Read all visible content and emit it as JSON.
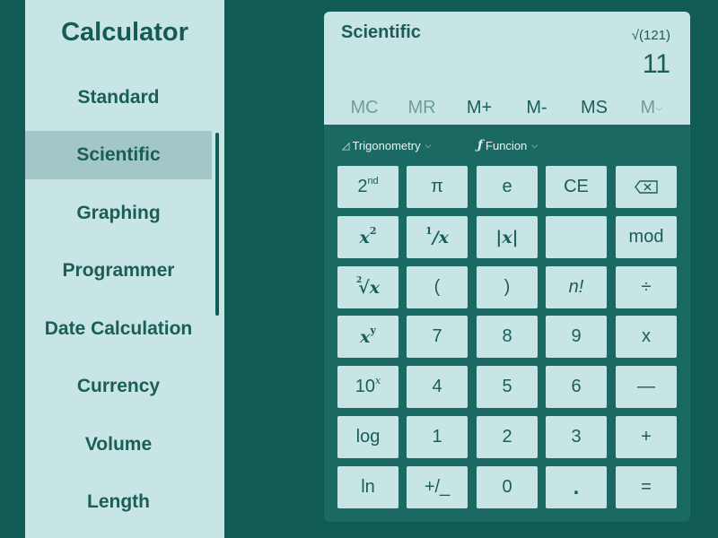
{
  "app": {
    "title": "Calculator"
  },
  "sidebar": {
    "items": [
      {
        "label": "Standard",
        "active": false
      },
      {
        "label": "Scientific",
        "active": true
      },
      {
        "label": "Graphing",
        "active": false
      },
      {
        "label": "Programmer",
        "active": false
      },
      {
        "label": "Date Calculation",
        "active": false
      },
      {
        "label": "Currency",
        "active": false
      },
      {
        "label": "Volume",
        "active": false
      },
      {
        "label": "Length",
        "active": false
      }
    ]
  },
  "display": {
    "mode": "Scientific",
    "expression": "√(121)",
    "result": "11"
  },
  "memory": {
    "buttons": [
      {
        "label": "MC",
        "enabled": false
      },
      {
        "label": "MR",
        "enabled": false
      },
      {
        "label": "M+",
        "enabled": true
      },
      {
        "label": "M-",
        "enabled": true
      },
      {
        "label": "MS",
        "enabled": true
      },
      {
        "label": "M",
        "enabled": false
      }
    ],
    "dropdown_icon": "chevron-down-icon"
  },
  "functions": {
    "trig_label": "Trigonometry",
    "trig_icon": "triangle-ruler-icon",
    "func_label": "Funcion",
    "func_icon": "function-icon"
  },
  "keys": {
    "second": {
      "base": "2",
      "sup": "nd"
    },
    "pi": "π",
    "e": "e",
    "ce": "CE",
    "backspace_icon": "backspace-icon",
    "x_squared": {
      "base": "x",
      "sup": "2"
    },
    "reciprocal": {
      "sup": "1",
      "rest": "/x"
    },
    "abs": "|x|",
    "blank": "",
    "mod": "mod",
    "root": {
      "index": "2",
      "radicand": "√x"
    },
    "open_paren": "(",
    "close_paren": ")",
    "factorial": "n!",
    "divide": "÷",
    "x_pow_y": {
      "base": "x",
      "sup": "y"
    },
    "seven": "7",
    "eight": "8",
    "nine": "9",
    "multiply": "x",
    "ten_pow_x": {
      "base": "10",
      "sup": "x"
    },
    "four": "4",
    "five": "5",
    "six": "6",
    "minus": "—",
    "log": "log",
    "one": "1",
    "two": "2",
    "three": "3",
    "plus": "+",
    "ln": "ln",
    "negate": "+/_",
    "zero": "0",
    "decimal": ".",
    "equals": "="
  },
  "colors": {
    "background": "#105c55",
    "panel": "#1a6a63",
    "key": "#c7e5e4",
    "sidebar": "#c7e5e4",
    "active_nav": "#a3c7c6",
    "text": "#1b5d57"
  }
}
